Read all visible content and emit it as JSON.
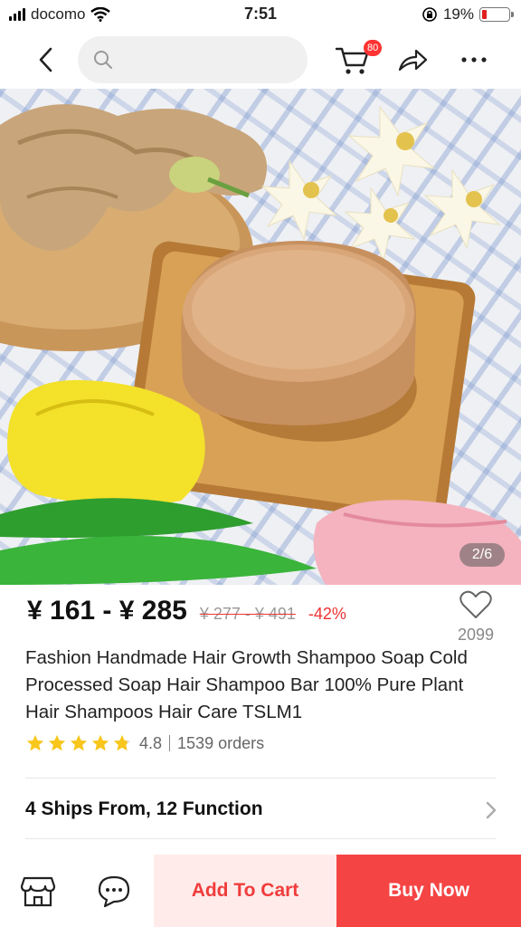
{
  "status_bar": {
    "carrier": "docomo",
    "time": "7:51",
    "battery_text": "19%",
    "battery_level": 0.19,
    "icons": [
      "signal-icon",
      "wifi-icon",
      "orientation-lock-icon",
      "battery-icon"
    ]
  },
  "nav": {
    "search_placeholder": "",
    "cart_badge": "80",
    "icons": [
      "back-arrow-icon",
      "search-icon",
      "cart-icon",
      "share-icon",
      "more-icon"
    ]
  },
  "gallery": {
    "page_indicator": "2/6"
  },
  "price": {
    "range": "¥ 161 - ¥ 285",
    "original": "¥ 277 - ¥ 491",
    "discount": "-42%"
  },
  "wishlist": {
    "count": "2099",
    "icon": "heart-icon"
  },
  "product": {
    "title": "Fashion Handmade Hair Growth Shampoo Soap Cold Processed Soap Hair Shampoo Bar 100% Pure Plant Hair Shampoos Hair Care TSLM1",
    "rating": "4.8",
    "rating_value": 4.8,
    "orders": "1539 orders"
  },
  "options": {
    "ships_label": "4 Ships From, 12 Function"
  },
  "bottom_bar": {
    "add_to_cart": "Add To Cart",
    "buy_now": "Buy Now",
    "icons": [
      "store-icon",
      "chat-icon"
    ]
  },
  "colors": {
    "accent": "#f54444",
    "accent_light": "#ffecea",
    "star": "#f8c61c",
    "discount": "#e33333"
  }
}
